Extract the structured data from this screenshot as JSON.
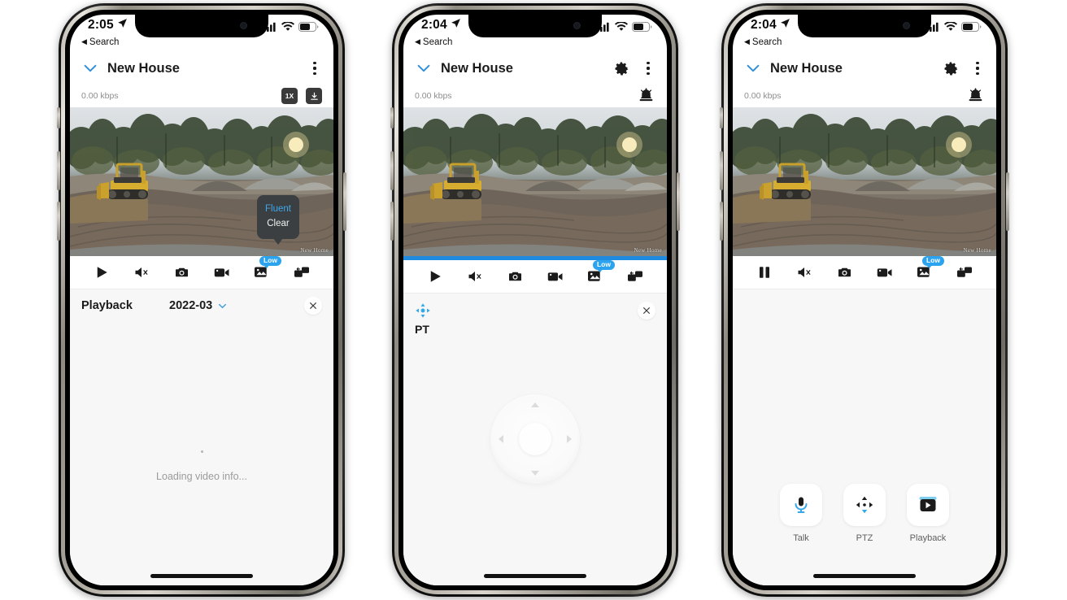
{
  "app": {
    "title": "New House",
    "back_label": "Search",
    "bitrate": "0.00 kbps",
    "watermark": "New Home",
    "accent_color": "#2ba3ef",
    "progress_color": "#1e8ae0"
  },
  "phones": [
    {
      "id": "phone-1",
      "status": {
        "time": "2:05",
        "location_icon": "location-arrow-icon",
        "signal": "signal-bars-icon",
        "wifi": "wifi-icon",
        "battery": "battery-icon"
      },
      "header": {
        "collapse_icon": "chevron-down-icon",
        "title": "New House",
        "has_gear": false,
        "menu_icon": "kebab-menu-icon"
      },
      "stats": {
        "bitrate": "0.00 kbps",
        "buttons": [
          {
            "name": "speed-button",
            "label": "1X"
          },
          {
            "name": "download-button",
            "label": "↓"
          }
        ],
        "has_alarm": false
      },
      "video": {
        "stream_menu": {
          "options": [
            {
              "label": "Fluent",
              "selected": true
            },
            {
              "label": "Clear",
              "selected": false
            }
          ]
        },
        "watermark": "New Home",
        "show_progress": false
      },
      "toolbar": [
        {
          "name": "play-button",
          "icon": "play-icon",
          "badge": null
        },
        {
          "name": "mute-button",
          "icon": "speaker-mute-icon",
          "badge": null
        },
        {
          "name": "snapshot-button",
          "icon": "camera-icon",
          "badge": null
        },
        {
          "name": "record-button",
          "icon": "video-camera-icon",
          "badge": null
        },
        {
          "name": "quality-button",
          "icon": "image-swap-icon",
          "badge": "Low"
        },
        {
          "name": "multiview-button",
          "icon": "picture-in-picture-icon",
          "badge": null
        }
      ],
      "panel": {
        "mode": "playback",
        "playback": {
          "label": "Playback",
          "date": "2022-03",
          "date_chevron": "chevron-down-icon",
          "close_icon": "close-icon",
          "loading_text": "Loading video info..."
        }
      }
    },
    {
      "id": "phone-2",
      "status": {
        "time": "2:04",
        "location_icon": "location-arrow-icon",
        "signal": "signal-bars-icon",
        "wifi": "wifi-icon",
        "battery": "battery-icon"
      },
      "header": {
        "collapse_icon": "chevron-down-icon",
        "title": "New House",
        "has_gear": true,
        "gear_icon": "gear-icon",
        "menu_icon": "kebab-menu-icon"
      },
      "stats": {
        "bitrate": "0.00 kbps",
        "buttons": [],
        "has_alarm": true,
        "alarm_icon": "alarm-bell-icon"
      },
      "video": {
        "stream_menu": null,
        "watermark": "New Home",
        "show_progress": true
      },
      "toolbar": [
        {
          "name": "play-button",
          "icon": "play-icon",
          "badge": null
        },
        {
          "name": "mute-button",
          "icon": "speaker-mute-icon",
          "badge": null
        },
        {
          "name": "snapshot-button",
          "icon": "camera-icon",
          "badge": null
        },
        {
          "name": "record-button",
          "icon": "video-camera-icon",
          "badge": null
        },
        {
          "name": "quality-button",
          "icon": "image-swap-icon",
          "badge": "Low"
        },
        {
          "name": "multiview-button",
          "icon": "picture-in-picture-icon",
          "badge": null
        }
      ],
      "panel": {
        "mode": "ptz",
        "ptz": {
          "icon": "pan-tilt-icon",
          "label": "PT",
          "close_icon": "close-icon",
          "dpad": {
            "up": "arrow-up-icon",
            "down": "arrow-down-icon",
            "left": "arrow-left-icon",
            "right": "arrow-right-icon",
            "center": "dpad-center-button"
          }
        }
      }
    },
    {
      "id": "phone-3",
      "status": {
        "time": "2:04",
        "location_icon": "location-arrow-icon",
        "signal": "signal-bars-icon",
        "wifi": "wifi-icon",
        "battery": "battery-icon"
      },
      "header": {
        "collapse_icon": "chevron-down-icon",
        "title": "New House",
        "has_gear": true,
        "gear_icon": "gear-icon",
        "menu_icon": "kebab-menu-icon"
      },
      "stats": {
        "bitrate": "0.00 kbps",
        "buttons": [],
        "has_alarm": true,
        "alarm_icon": "alarm-bell-icon"
      },
      "video": {
        "stream_menu": null,
        "watermark": "New Home",
        "show_progress": false
      },
      "toolbar": [
        {
          "name": "pause-button",
          "icon": "pause-icon",
          "badge": null
        },
        {
          "name": "mute-button",
          "icon": "speaker-mute-icon",
          "badge": null
        },
        {
          "name": "snapshot-button",
          "icon": "camera-icon",
          "badge": null
        },
        {
          "name": "record-button",
          "icon": "video-camera-icon",
          "badge": null
        },
        {
          "name": "quality-button",
          "icon": "image-swap-icon",
          "badge": "Low"
        },
        {
          "name": "multiview-button",
          "icon": "picture-in-picture-icon",
          "badge": null
        }
      ],
      "panel": {
        "mode": "actions",
        "actions": [
          {
            "name": "talk-button",
            "icon": "microphone-icon",
            "label": "Talk"
          },
          {
            "name": "ptz-button",
            "icon": "four-arrows-icon",
            "label": "PTZ"
          },
          {
            "name": "playback-button",
            "icon": "video-play-icon",
            "label": "Playback"
          }
        ]
      }
    }
  ]
}
